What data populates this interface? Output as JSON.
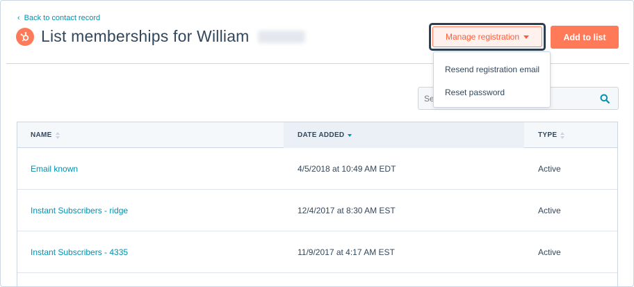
{
  "header": {
    "back_link": "Back to contact record",
    "title": "List memberships for William"
  },
  "actions": {
    "manage_label": "Manage registration",
    "add_label": "Add to list"
  },
  "dropdown": {
    "items": [
      {
        "label": "Resend registration email"
      },
      {
        "label": "Reset password"
      }
    ]
  },
  "search": {
    "placeholder": "Se"
  },
  "table": {
    "columns": [
      {
        "label": "NAME"
      },
      {
        "label": "DATE ADDED"
      },
      {
        "label": "TYPE"
      }
    ],
    "rows": [
      {
        "name": "Email known",
        "date": "4/5/2018 at 10:49 AM EDT",
        "type": "Active"
      },
      {
        "name": "Instant Subscribers - ridge",
        "date": "12/4/2017 at 8:30 AM EST",
        "type": "Active"
      },
      {
        "name": "Instant Subscribers - 4335",
        "date": "11/9/2017 at 4:17 AM EST",
        "type": "Active"
      }
    ]
  },
  "colors": {
    "accent": "#ff7a59",
    "link": "#0091ae",
    "text": "#33475b"
  },
  "icons": {
    "back": "chevron-left-icon",
    "logo": "hubspot-sprocket-icon",
    "caret": "caret-down-icon",
    "search": "search-icon",
    "sort": "sort-icon"
  }
}
